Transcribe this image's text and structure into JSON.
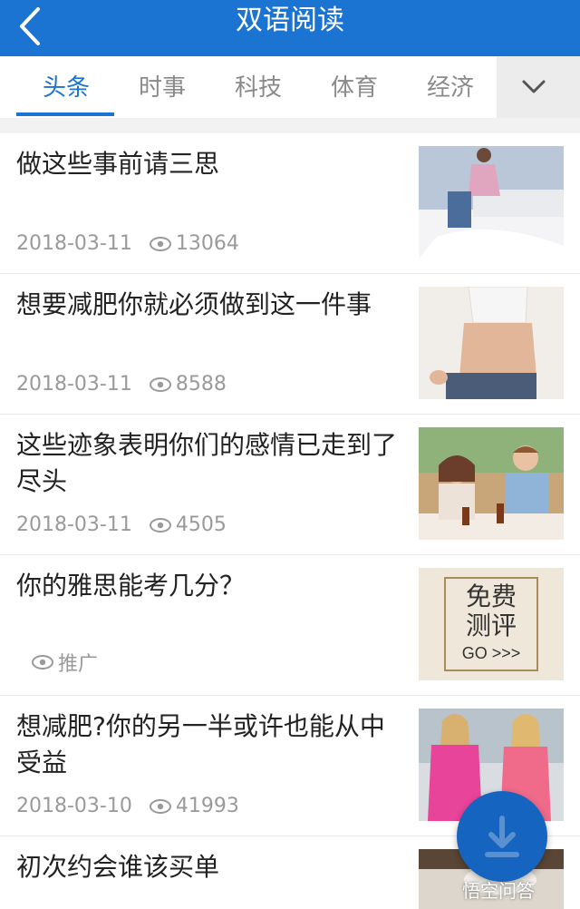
{
  "header": {
    "title": "双语阅读"
  },
  "tabs": [
    {
      "label": "头条"
    },
    {
      "label": "时事"
    },
    {
      "label": "科技"
    },
    {
      "label": "体育"
    },
    {
      "label": "经济"
    }
  ],
  "articles": [
    {
      "title": "做这些事前请三思",
      "date": "2018-03-11",
      "views": "13064"
    },
    {
      "title": "想要减肥你就必须做到这一件事",
      "date": "2018-03-11",
      "views": "8588"
    },
    {
      "title": "这些迹象表明你们的感情已走到了尽头",
      "date": "2018-03-11",
      "views": "4505"
    },
    {
      "title": "你的雅思能考几分？",
      "tag": "推广",
      "ad_lines": [
        "免费",
        "测评",
        "GO >>>"
      ]
    },
    {
      "title": "想减肥?你的另一半或许也能从中受益",
      "date": "2018-03-10",
      "views": "41993"
    },
    {
      "title": "初次约会谁该买单"
    }
  ],
  "watermark": "悟空问答",
  "colors": {
    "brand": "#1b73d2",
    "fab": "#1565c0"
  },
  "icons": {
    "back": "chevron-left-icon",
    "more": "chevron-down-icon",
    "views": "eye-icon",
    "download": "download-icon"
  }
}
